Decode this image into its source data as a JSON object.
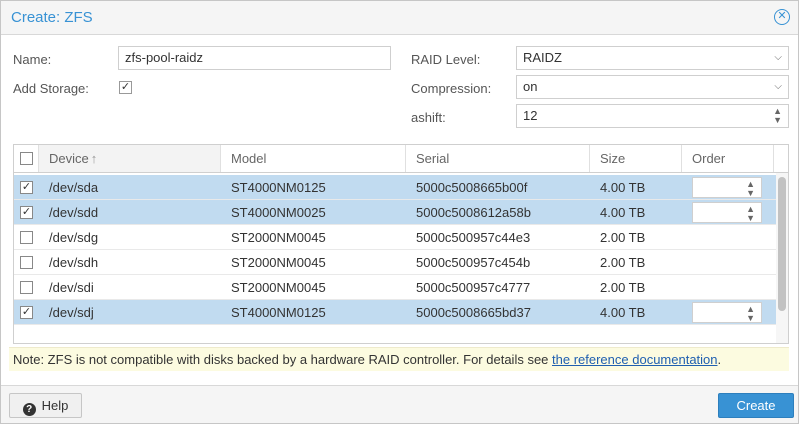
{
  "dialog": {
    "title": "Create: ZFS"
  },
  "form": {
    "name_label": "Name:",
    "name_value": "zfs-pool-raidz",
    "add_storage_label": "Add Storage:",
    "add_storage_checked": true,
    "raid_label": "RAID Level:",
    "raid_value": "RAIDZ",
    "compression_label": "Compression:",
    "compression_value": "on",
    "ashift_label": "ashift:",
    "ashift_value": "12"
  },
  "grid": {
    "columns": [
      "Device",
      "Model",
      "Serial",
      "Size",
      "Order"
    ],
    "sort_indicator": "↑",
    "rows": [
      {
        "device": "/dev/sda",
        "model": "ST4000NM0125",
        "serial": "5000c5008665b00f",
        "size": "4.00 TB",
        "checked": true
      },
      {
        "device": "/dev/sdd",
        "model": "ST4000NM0025",
        "serial": "5000c5008612a58b",
        "size": "4.00 TB",
        "checked": true
      },
      {
        "device": "/dev/sdg",
        "model": "ST2000NM0045",
        "serial": "5000c500957c44e3",
        "size": "2.00 TB",
        "checked": false
      },
      {
        "device": "/dev/sdh",
        "model": "ST2000NM0045",
        "serial": "5000c500957c454b",
        "size": "2.00 TB",
        "checked": false
      },
      {
        "device": "/dev/sdi",
        "model": "ST2000NM0045",
        "serial": "5000c500957c4777",
        "size": "2.00 TB",
        "checked": false
      },
      {
        "device": "/dev/sdj",
        "model": "ST4000NM0125",
        "serial": "5000c5008665bd37",
        "size": "4.00 TB",
        "checked": true
      }
    ]
  },
  "note": {
    "text": "Note: ZFS is not compatible with disks backed by a hardware RAID controller. For details see ",
    "link_text": "the reference documentation",
    "suffix": "."
  },
  "footer": {
    "help_label": "Help",
    "create_label": "Create"
  },
  "colors": {
    "accent": "#3892d4",
    "selected_row": "#c1dbf0",
    "note_bg": "#fcfbe0"
  }
}
